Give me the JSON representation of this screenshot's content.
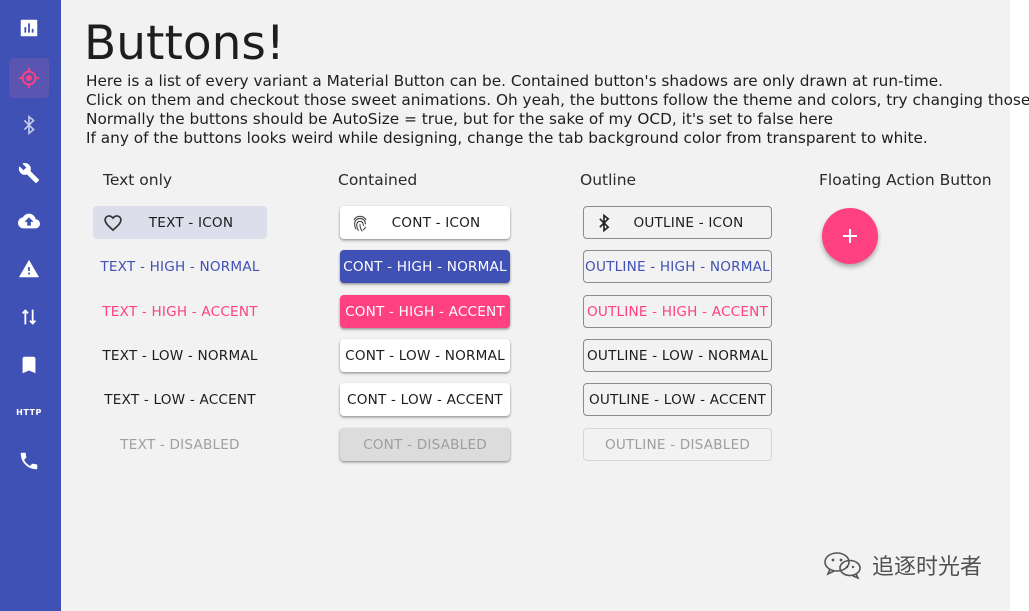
{
  "theme": {
    "primary": "#3f51b5",
    "accent": "#ff4081",
    "background": "#f2f2f2"
  },
  "sidebar": {
    "items": [
      {
        "icon": "bar-chart-icon"
      },
      {
        "icon": "gps-target-icon",
        "active": true
      },
      {
        "icon": "bluetooth-icon"
      },
      {
        "icon": "wrench-icon"
      },
      {
        "icon": "cloud-upload-icon"
      },
      {
        "icon": "warning-icon"
      },
      {
        "icon": "swap-vertical-icon"
      },
      {
        "icon": "bookmark-icon"
      },
      {
        "icon": "http-icon",
        "label": "HTTP"
      },
      {
        "icon": "phone-icon"
      }
    ]
  },
  "header": {
    "title": "Buttons!",
    "lines": [
      "Here is a list of every variant a Material Button can be. Contained button's shadows are only drawn at run-time.",
      "Click on them and checkout those sweet animations. Oh yeah, the buttons follow the theme and colors, try changing those too.",
      "Normally the buttons should be AutoSize = true, but for the sake of my OCD, it's set to false here",
      "If any of the buttons looks weird while designing, change the tab background color from transparent to white."
    ]
  },
  "columns": {
    "text": {
      "header": "Text only",
      "buttons": [
        {
          "label": "TEXT - ICON",
          "icon": "heart-outline-icon"
        },
        {
          "label": "TEXT - HIGH - NORMAL"
        },
        {
          "label": "TEXT - HIGH - ACCENT"
        },
        {
          "label": "TEXT - LOW - NORMAL"
        },
        {
          "label": "TEXT - LOW - ACCENT"
        },
        {
          "label": "TEXT - DISABLED"
        }
      ]
    },
    "contained": {
      "header": "Contained",
      "buttons": [
        {
          "label": "CONT - ICON",
          "icon": "fingerprint-icon"
        },
        {
          "label": "CONT - HIGH - NORMAL"
        },
        {
          "label": "CONT - HIGH - ACCENT"
        },
        {
          "label": "CONT - LOW - NORMAL"
        },
        {
          "label": "CONT - LOW - ACCENT"
        },
        {
          "label": "CONT - DISABLED"
        }
      ]
    },
    "outline": {
      "header": "Outline",
      "buttons": [
        {
          "label": "OUTLINE - ICON",
          "icon": "bluetooth-icon"
        },
        {
          "label": "OUTLINE - HIGH - NORMAL"
        },
        {
          "label": "OUTLINE - HIGH - ACCENT"
        },
        {
          "label": "OUTLINE - LOW - NORMAL"
        },
        {
          "label": "OUTLINE - LOW - ACCENT"
        },
        {
          "label": "OUTLINE - DISABLED"
        }
      ]
    },
    "fab": {
      "header": "Floating Action Button",
      "icon": "plus-icon",
      "symbol": "+"
    }
  },
  "watermark": {
    "text": "追逐时光者",
    "icon": "wechat-icon"
  }
}
